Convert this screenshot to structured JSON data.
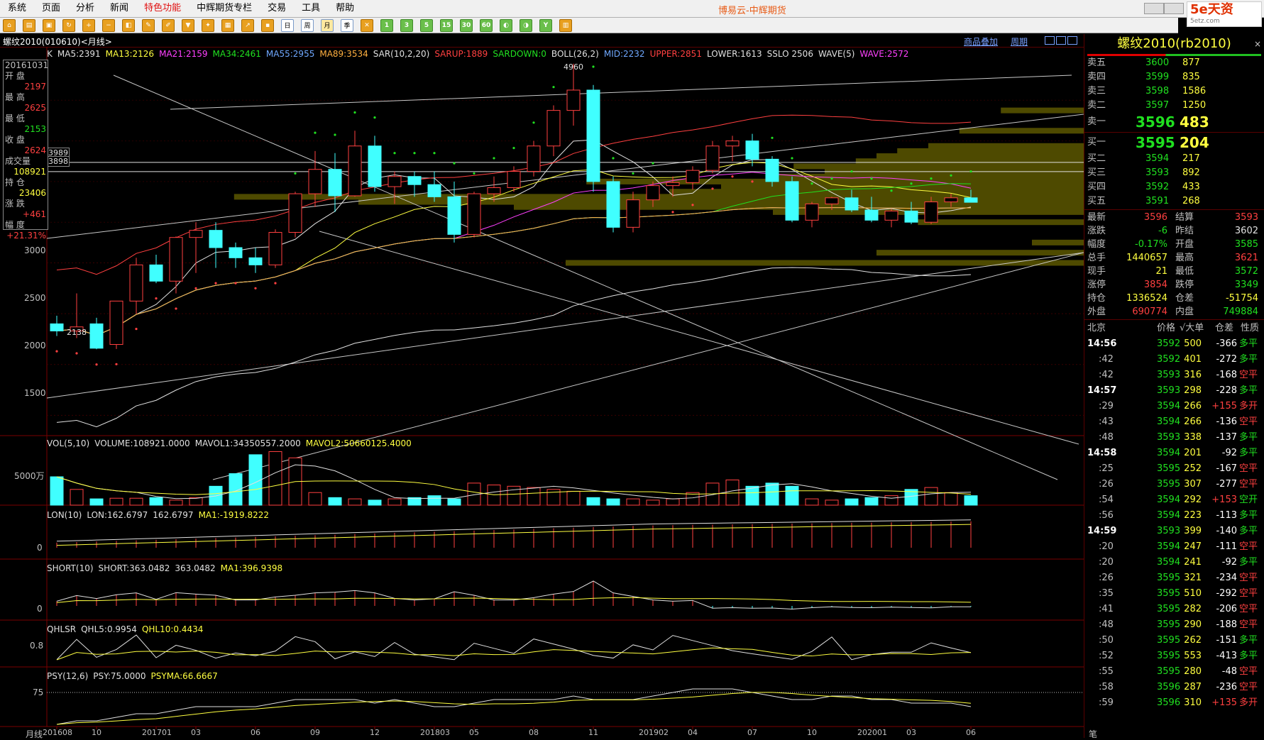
{
  "menubar": {
    "items": [
      {
        "label": "系统",
        "highlight": false
      },
      {
        "label": "页面",
        "highlight": false
      },
      {
        "label": "分析",
        "highlight": false
      },
      {
        "label": "新闻",
        "highlight": false
      },
      {
        "label": "特色功能",
        "highlight": true
      },
      {
        "label": "中辉期货专栏",
        "highlight": false
      },
      {
        "label": "交易",
        "highlight": false
      },
      {
        "label": "工具",
        "highlight": false
      },
      {
        "label": "帮助",
        "highlight": false
      }
    ],
    "app_title": "博易云-中辉期货",
    "logo_text": "5e天资",
    "logo_sub": "5etz.com"
  },
  "toolbar": {
    "numbered": [
      "1",
      "3",
      "5",
      "15",
      "30",
      "60"
    ],
    "period_labels": [
      "日",
      "周",
      "月",
      "季",
      "年"
    ]
  },
  "header": {
    "symbol": "螺纹2010(010610)<月线>",
    "overlay_link": "商品叠加",
    "period_link": "周期"
  },
  "main_indicators": [
    {
      "text": "K",
      "color": "#e0e0e0"
    },
    {
      "text": "MA5:2391",
      "color": "#e0e0e0"
    },
    {
      "text": "MA13:2126",
      "color": "#ffff40"
    },
    {
      "text": "MA21:2159",
      "color": "#ff40ff"
    },
    {
      "text": "MA34:2461",
      "color": "#20e020"
    },
    {
      "text": "MA55:2955",
      "color": "#6fa8ff"
    },
    {
      "text": "MA89:3534",
      "color": "#ffb040"
    },
    {
      "text": "SAR(10,2,20)",
      "color": "#e0e0e0"
    },
    {
      "text": "SARUP:1889",
      "color": "#ff4040"
    },
    {
      "text": "SARDOWN:0",
      "color": "#20e020"
    },
    {
      "text": "BOLL(26,2)",
      "color": "#e0e0e0"
    },
    {
      "text": "MID:2232",
      "color": "#6fa8ff"
    },
    {
      "text": "UPPER:2851",
      "color": "#ff4040"
    },
    {
      "text": "LOWER:1613",
      "color": "#e0e0e0"
    },
    {
      "text": "SSLO 2506",
      "color": "#e0e0e0"
    },
    {
      "text": "WAVE(5)",
      "color": "#e0e0e0"
    },
    {
      "text": "WAVE:2572",
      "color": "#ff40ff"
    }
  ],
  "price_axis": [
    "3000",
    "2500",
    "2000",
    "1500"
  ],
  "price_marks": {
    "high": "4960",
    "low": "2138",
    "line1": "3989",
    "line2": "3898"
  },
  "data_window": [
    {
      "label": "20161031",
      "value": "",
      "color": "#e0e0e0"
    },
    {
      "label": "开  盘",
      "value": "2197",
      "color": "#ff4040"
    },
    {
      "label": "最  高",
      "value": "2625",
      "color": "#ff4040"
    },
    {
      "label": "最  低",
      "value": "2153",
      "color": "#20e020"
    },
    {
      "label": "收  盘",
      "value": "2624",
      "color": "#ff4040"
    },
    {
      "label": "成交量",
      "value": "108921",
      "color": "#ffff40"
    },
    {
      "label": "持  仓",
      "value": "23406",
      "color": "#ffff40"
    },
    {
      "label": "涨  跌",
      "value": "+461",
      "color": "#ff4040"
    },
    {
      "label": "幅  度",
      "value": "+21.31%",
      "color": "#ff4040"
    }
  ],
  "vol_panel": {
    "indicators": [
      {
        "text": "VOL(5,10)",
        "color": "#e0e0e0"
      },
      {
        "text": "VOLUME:108921.0000",
        "color": "#e0e0e0"
      },
      {
        "text": "MAVOL1:34350557.2000",
        "color": "#e0e0e0"
      },
      {
        "text": "MAVOL2:50660125.4000",
        "color": "#ffff40"
      }
    ],
    "axis": "5000万"
  },
  "lon_panel": {
    "indicators": [
      {
        "text": "LON(10)",
        "color": "#e0e0e0"
      },
      {
        "text": "LON:162.6797",
        "color": "#e0e0e0"
      },
      {
        "text": "162.6797",
        "color": "#e0e0e0"
      },
      {
        "text": "MA1:-1919.8222",
        "color": "#ffff40"
      }
    ],
    "axis": "0"
  },
  "short_panel": {
    "indicators": [
      {
        "text": "SHORT(10)",
        "color": "#e0e0e0"
      },
      {
        "text": "SHORT:363.0482",
        "color": "#e0e0e0"
      },
      {
        "text": "363.0482",
        "color": "#e0e0e0"
      },
      {
        "text": "MA1:396.9398",
        "color": "#ffff40"
      }
    ],
    "axis": "0"
  },
  "qhlsr_panel": {
    "indicators": [
      {
        "text": "QHLSR",
        "color": "#e0e0e0"
      },
      {
        "text": "QHL5:0.9954",
        "color": "#e0e0e0"
      },
      {
        "text": "QHL10:0.4434",
        "color": "#ffff40"
      }
    ],
    "axis": "0.8"
  },
  "psy_panel": {
    "indicators": [
      {
        "text": "PSY(12,6)",
        "color": "#e0e0e0"
      },
      {
        "text": "PSY:75.0000",
        "color": "#e0e0e0"
      },
      {
        "text": "PSYMA:66.6667",
        "color": "#ffff40"
      }
    ],
    "axis": "75"
  },
  "time_axis": {
    "period_label": "月线",
    "ticks": [
      "201608",
      "10",
      "201701",
      "03",
      "06",
      "09",
      "12",
      "201803",
      "05",
      "08",
      "11",
      "201902",
      "04",
      "07",
      "10",
      "202001",
      "03",
      "06"
    ]
  },
  "quote": {
    "title": "螺纹2010(rb2010)",
    "close_label": "×",
    "asks": [
      {
        "label": "卖五",
        "price": "3600",
        "vol": "877"
      },
      {
        "label": "卖四",
        "price": "3599",
        "vol": "835"
      },
      {
        "label": "卖三",
        "price": "3598",
        "vol": "1586"
      },
      {
        "label": "卖二",
        "price": "3597",
        "vol": "1250"
      },
      {
        "label": "卖一",
        "price": "3596",
        "vol": "483"
      }
    ],
    "bids": [
      {
        "label": "买一",
        "price": "3595",
        "vol": "204"
      },
      {
        "label": "买二",
        "price": "3594",
        "vol": "217"
      },
      {
        "label": "买三",
        "price": "3593",
        "vol": "892"
      },
      {
        "label": "买四",
        "price": "3592",
        "vol": "433"
      },
      {
        "label": "买五",
        "price": "3591",
        "vol": "268"
      }
    ],
    "stats": [
      {
        "l1": "最新",
        "v1": "3596",
        "c1": "#ff4040",
        "l2": "结算",
        "v2": "3593",
        "c2": "#ff4040"
      },
      {
        "l1": "涨跌",
        "v1": "-6",
        "c1": "#20e020",
        "l2": "昨结",
        "v2": "3602",
        "c2": "#e0e0e0"
      },
      {
        "l1": "幅度",
        "v1": "-0.17%",
        "c1": "#20e020",
        "l2": "开盘",
        "v2": "3585",
        "c2": "#20e020"
      },
      {
        "l1": "总手",
        "v1": "1440657",
        "c1": "#ffff40",
        "l2": "最高",
        "v2": "3621",
        "c2": "#ff4040"
      },
      {
        "l1": "现手",
        "v1": "21",
        "c1": "#ffff40",
        "l2": "最低",
        "v2": "3572",
        "c2": "#20e020"
      },
      {
        "l1": "涨停",
        "v1": "3854",
        "c1": "#ff4040",
        "l2": "跌停",
        "v2": "3349",
        "c2": "#20e020"
      },
      {
        "l1": "持仓",
        "v1": "1336524",
        "c1": "#ffff40",
        "l2": "仓差",
        "v2": "-51754",
        "c2": "#ffff40"
      },
      {
        "l1": "外盘",
        "v1": "690774",
        "c1": "#ff4040",
        "l2": "内盘",
        "v2": "749884",
        "c2": "#20e020"
      }
    ],
    "tick_header": {
      "time": "北京",
      "price": "价格",
      "vol": "√大单",
      "oi": "仓差",
      "nature": "性质"
    },
    "ticks": [
      {
        "t": "14:56",
        "p": "3592",
        "v": "500",
        "d": "-366",
        "n": "多平",
        "nc": "#20e020"
      },
      {
        "t": ":42",
        "p": "3592",
        "v": "401",
        "d": "-272",
        "n": "多平",
        "nc": "#20e020"
      },
      {
        "t": ":42",
        "p": "3593",
        "v": "316",
        "d": "-168",
        "n": "空平",
        "nc": "#ff4040"
      },
      {
        "t": "14:57",
        "p": "3593",
        "v": "298",
        "d": "-228",
        "n": "多平",
        "nc": "#20e020"
      },
      {
        "t": ":29",
        "p": "3594",
        "v": "266",
        "d": "+155",
        "n": "多开",
        "nc": "#ff4040"
      },
      {
        "t": ":43",
        "p": "3594",
        "v": "266",
        "d": "-136",
        "n": "空平",
        "nc": "#ff4040"
      },
      {
        "t": ":48",
        "p": "3593",
        "v": "338",
        "d": "-137",
        "n": "多平",
        "nc": "#20e020"
      },
      {
        "t": "14:58",
        "p": "3594",
        "v": "201",
        "d": "-92",
        "n": "多平",
        "nc": "#20e020"
      },
      {
        "t": ":25",
        "p": "3595",
        "v": "252",
        "d": "-167",
        "n": "空平",
        "nc": "#ff4040"
      },
      {
        "t": ":26",
        "p": "3595",
        "v": "307",
        "d": "-277",
        "n": "空平",
        "nc": "#ff4040"
      },
      {
        "t": ":54",
        "p": "3594",
        "v": "292",
        "d": "+153",
        "n": "空开",
        "nc": "#20e020"
      },
      {
        "t": ":56",
        "p": "3594",
        "v": "223",
        "d": "-113",
        "n": "多平",
        "nc": "#20e020"
      },
      {
        "t": "14:59",
        "p": "3593",
        "v": "399",
        "d": "-140",
        "n": "多平",
        "nc": "#20e020"
      },
      {
        "t": ":20",
        "p": "3594",
        "v": "247",
        "d": "-111",
        "n": "空平",
        "nc": "#ff4040"
      },
      {
        "t": ":20",
        "p": "3594",
        "v": "241",
        "d": "-92",
        "n": "多平",
        "nc": "#20e020"
      },
      {
        "t": ":26",
        "p": "3595",
        "v": "321",
        "d": "-234",
        "n": "空平",
        "nc": "#ff4040"
      },
      {
        "t": ":35",
        "p": "3595",
        "v": "510",
        "d": "-292",
        "n": "空平",
        "nc": "#ff4040"
      },
      {
        "t": ":41",
        "p": "3595",
        "v": "282",
        "d": "-206",
        "n": "空平",
        "nc": "#ff4040"
      },
      {
        "t": ":48",
        "p": "3595",
        "v": "290",
        "d": "-188",
        "n": "空平",
        "nc": "#ff4040"
      },
      {
        "t": ":50",
        "p": "3595",
        "v": "262",
        "d": "-151",
        "n": "多平",
        "nc": "#20e020"
      },
      {
        "t": ":52",
        "p": "3595",
        "v": "553",
        "d": "-413",
        "n": "多平",
        "nc": "#20e020"
      },
      {
        "t": ":55",
        "p": "3595",
        "v": "280",
        "d": "-48",
        "n": "空平",
        "nc": "#ff4040"
      },
      {
        "t": ":58",
        "p": "3596",
        "v": "287",
        "d": "-236",
        "n": "空平",
        "nc": "#ff4040"
      },
      {
        "t": ":59",
        "p": "3596",
        "v": "310",
        "d": "+135",
        "n": "多开",
        "nc": "#ff4040"
      }
    ],
    "footer": "笔"
  },
  "chart_data": {
    "type": "candlestick",
    "title": "螺纹2010(010610)<月线>",
    "ylim": [
      1300,
      5000
    ],
    "months": [
      "201608",
      "201609",
      "201610",
      "201611",
      "201612",
      "201701",
      "201702",
      "201703",
      "201704",
      "201705",
      "201706",
      "201707",
      "201708",
      "201709",
      "201710",
      "201711",
      "201712",
      "201801",
      "201802",
      "201803",
      "201804",
      "201805",
      "201806",
      "201807",
      "201808",
      "201809",
      "201810",
      "201811",
      "201812",
      "201901",
      "201902",
      "201903",
      "201904",
      "201905",
      "201906",
      "201907",
      "201908",
      "201909",
      "201910",
      "201911",
      "201912",
      "202001",
      "202002",
      "202003",
      "202004",
      "202005",
      "202006"
    ],
    "ohlc": [
      [
        2400,
        2480,
        2280,
        2330
      ],
      [
        2330,
        2700,
        2260,
        2370
      ],
      [
        2400,
        2460,
        2150,
        2160
      ],
      [
        2197,
        2625,
        2153,
        2624
      ],
      [
        2624,
        3050,
        2500,
        2980
      ],
      [
        2980,
        3080,
        2800,
        2820
      ],
      [
        2820,
        3260,
        2700,
        3250
      ],
      [
        3250,
        3400,
        2900,
        3320
      ],
      [
        3320,
        3400,
        2950,
        3150
      ],
      [
        3150,
        3200,
        2950,
        3050
      ],
      [
        3050,
        3150,
        2900,
        2980
      ],
      [
        2980,
        3330,
        2950,
        3300
      ],
      [
        3300,
        3700,
        3250,
        3680
      ],
      [
        3680,
        4100,
        3550,
        3920
      ],
      [
        3920,
        4080,
        3500,
        3660
      ],
      [
        3660,
        4300,
        3650,
        4150
      ],
      [
        4150,
        4250,
        3700,
        3750
      ],
      [
        3750,
        3900,
        3580,
        3850
      ],
      [
        3850,
        3900,
        3650,
        3770
      ],
      [
        3770,
        3900,
        3600,
        3650
      ],
      [
        3650,
        3800,
        3200,
        3280
      ],
      [
        3280,
        3700,
        3250,
        3680
      ],
      [
        3680,
        3850,
        3600,
        3740
      ],
      [
        3740,
        3950,
        3700,
        3900
      ],
      [
        3900,
        4200,
        3850,
        4150
      ],
      [
        4150,
        4550,
        4050,
        4500
      ],
      [
        4500,
        4960,
        4350,
        4700
      ],
      [
        4700,
        4750,
        3700,
        3800
      ],
      [
        3800,
        3850,
        3300,
        3350
      ],
      [
        3350,
        3700,
        3300,
        3620
      ],
      [
        3620,
        3800,
        3550,
        3760
      ],
      [
        3760,
        3850,
        3650,
        3790
      ],
      [
        3790,
        3950,
        3720,
        3910
      ],
      [
        3910,
        4200,
        3880,
        4150
      ],
      [
        4150,
        4250,
        4000,
        4200
      ],
      [
        4200,
        4270,
        3950,
        4020
      ],
      [
        4020,
        4050,
        3750,
        3800
      ],
      [
        3800,
        3850,
        3400,
        3420
      ],
      [
        3420,
        3600,
        3350,
        3580
      ],
      [
        3580,
        3650,
        3520,
        3640
      ],
      [
        3640,
        3720,
        3500,
        3520
      ],
      [
        3520,
        3650,
        3400,
        3420
      ],
      [
        3420,
        3530,
        3350,
        3510
      ],
      [
        3510,
        3600,
        3380,
        3400
      ],
      [
        3400,
        3650,
        3380,
        3600
      ],
      [
        3600,
        3680,
        3550,
        3640
      ],
      [
        3640,
        3720,
        3600,
        3596
      ]
    ],
    "volume": [
      45,
      25,
      10,
      11,
      11,
      12,
      8,
      12,
      30,
      50,
      80,
      85,
      75,
      20,
      12,
      10,
      8,
      10,
      12,
      15,
      10,
      35,
      32,
      30,
      28,
      25,
      22,
      12,
      10,
      10,
      8,
      10,
      20,
      35,
      40,
      30,
      35,
      30,
      10,
      8,
      10,
      12,
      15,
      25,
      28,
      20,
      15
    ],
    "grid": true
  }
}
